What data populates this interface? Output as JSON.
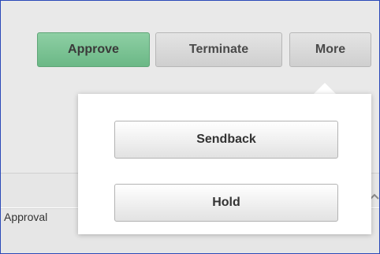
{
  "toolbar": {
    "approve_label": "Approve",
    "terminate_label": "Terminate",
    "more_label": "More"
  },
  "more_menu": {
    "items": [
      {
        "label": "Sendback"
      },
      {
        "label": "Hold"
      }
    ]
  },
  "background": {
    "approval_label": "Approval"
  },
  "colors": {
    "approve_bg": "#7cc295",
    "button_bg": "#d9d9d9",
    "frame_border": "#2a49b8"
  },
  "icons": {
    "collapse": "chevron-up-icon"
  }
}
